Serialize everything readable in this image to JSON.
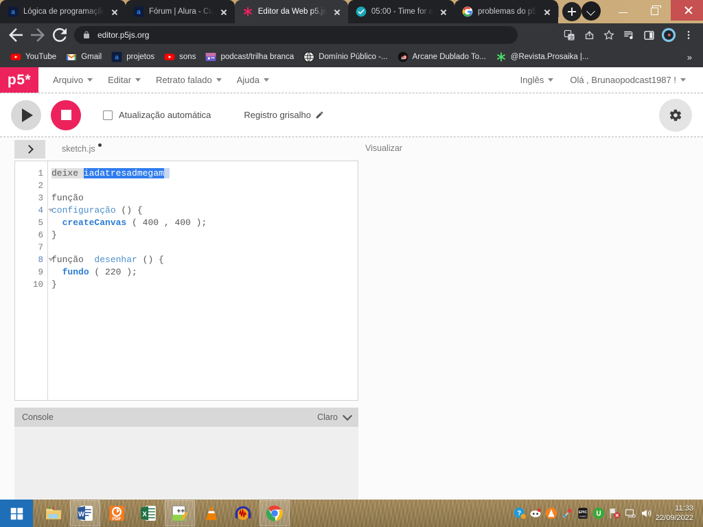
{
  "browser": {
    "tabs": [
      {
        "title": "Lógica de programação",
        "icon": "alura-icon",
        "active": false
      },
      {
        "title": "Fórum | Alura - Cu",
        "icon": "alura-icon",
        "active": false
      },
      {
        "title": "Editor da Web p5.js",
        "icon": "p5-asterisk-icon",
        "active": true
      },
      {
        "title": "05:00 - Time for a",
        "icon": "timer-check-icon",
        "active": false
      },
      {
        "title": "problemas do p5",
        "icon": "google-icon",
        "active": false
      }
    ],
    "new_tab_label": "+",
    "window_controls": {
      "minimize": "–",
      "maximize": "❐",
      "close": "✕"
    },
    "address": {
      "url": "editor.p5js.org",
      "lock_icon": "lock-icon",
      "back_icon": "back-arrow-icon",
      "forward_icon": "forward-arrow-icon",
      "reload_icon": "reload-icon"
    },
    "toolbar_icons": [
      "translate-icon",
      "share-icon",
      "bookmark-star-icon",
      "media-playlist-icon",
      "sidepanel-icon",
      "profile-avatar-icon",
      "chrome-menu-icon"
    ],
    "bookmarks": [
      {
        "label": "YouTube",
        "icon": "youtube-icon"
      },
      {
        "label": "Gmail",
        "icon": "gmail-icon"
      },
      {
        "label": "projetos",
        "icon": "alura-icon"
      },
      {
        "label": "sons",
        "icon": "youtube-icon"
      },
      {
        "label": "podcast/trilha branca",
        "icon": "podcast-thumb-icon"
      },
      {
        "label": "Domínio Público -...",
        "icon": "globe-icon"
      },
      {
        "label": "Arcane Dublado To...",
        "icon": "adblock-icon"
      },
      {
        "label": "@Revista.Prosaika |...",
        "icon": "asterisk-green-icon"
      }
    ],
    "bookmarks_overflow": "»"
  },
  "p5": {
    "logo": "p5*",
    "menu": [
      {
        "label": "Arquivo"
      },
      {
        "label": "Editar"
      },
      {
        "label": "Retrato falado"
      },
      {
        "label": "Ajuda"
      }
    ],
    "language": "Inglês",
    "account": "Olá , Brunaopodcast1987 !",
    "toolbar": {
      "play_label": "play-button",
      "stop_label": "stop-button",
      "autorefresh_label": "Atualização automática",
      "autorefresh_checked": false,
      "log_label": "Registro grisalho",
      "log_icon": "pencil-icon",
      "settings_icon": "gear-icon"
    },
    "file": {
      "name": "sketch.js",
      "unsaved": true,
      "sidebar_toggle_icon": "chevron-right-icon"
    },
    "preview_label": "Visualizar",
    "console": {
      "title": "Console",
      "theme": "Claro",
      "collapse_icon": "chevron-down-icon"
    },
    "editor": {
      "line_numbers": [
        "1",
        "2",
        "3",
        "4",
        "5",
        "6",
        "7",
        "8",
        "9",
        "10"
      ],
      "fold_lines": [
        4,
        8
      ],
      "marked_lines": [
        4,
        8
      ],
      "lines": [
        {
          "n": 1,
          "tokens": [
            {
              "t": "deixe ",
              "c": "kw",
              "bg": "hl"
            },
            {
              "t": "iadatresadmegam",
              "c": "sel"
            },
            {
              "t": " ",
              "c": "selpad"
            }
          ]
        },
        {
          "n": 2,
          "tokens": []
        },
        {
          "n": 3,
          "tokens": [
            {
              "t": "função",
              "c": "kw"
            }
          ]
        },
        {
          "n": 4,
          "tokens": [
            {
              "t": "configuração",
              "c": "name"
            },
            {
              "t": " () {",
              "c": "punct"
            }
          ]
        },
        {
          "n": 5,
          "tokens": [
            {
              "t": "  ",
              "c": "punct"
            },
            {
              "t": "createCanvas",
              "c": "fn"
            },
            {
              "t": " ( ",
              "c": "punct"
            },
            {
              "t": "400",
              "c": "num"
            },
            {
              "t": " , ",
              "c": "punct"
            },
            {
              "t": "400",
              "c": "num"
            },
            {
              "t": " );",
              "c": "punct"
            }
          ]
        },
        {
          "n": 6,
          "tokens": [
            {
              "t": "}",
              "c": "punct"
            }
          ]
        },
        {
          "n": 7,
          "tokens": []
        },
        {
          "n": 8,
          "tokens": [
            {
              "t": "função",
              "c": "kw"
            },
            {
              "t": "  ",
              "c": "punct"
            },
            {
              "t": "desenhar",
              "c": "name"
            },
            {
              "t": " () {",
              "c": "punct"
            }
          ]
        },
        {
          "n": 9,
          "tokens": [
            {
              "t": "  ",
              "c": "punct"
            },
            {
              "t": "fundo",
              "c": "fn"
            },
            {
              "t": " ( ",
              "c": "punct"
            },
            {
              "t": "220",
              "c": "num"
            },
            {
              "t": " );",
              "c": "punct"
            }
          ]
        },
        {
          "n": 10,
          "tokens": [
            {
              "t": "}",
              "c": "punct"
            }
          ]
        }
      ]
    },
    "colors": {
      "brand": "#ed225d",
      "selection": "#2f7ced",
      "keyword": "#5a5a5a",
      "function": "#2d7dd2"
    }
  },
  "taskbar": {
    "start_icon": "windows-start-icon",
    "apps": [
      {
        "icon": "file-explorer-icon",
        "open": false
      },
      {
        "icon": "word-icon",
        "open": true
      },
      {
        "icon": "pdf-icon",
        "open": false
      },
      {
        "icon": "excel-icon",
        "open": false
      },
      {
        "icon": "notepadpp-icon",
        "open": true
      },
      {
        "icon": "vlc-icon",
        "open": false
      },
      {
        "icon": "audacity-icon",
        "open": false
      },
      {
        "icon": "chrome-icon",
        "open": true
      }
    ],
    "tray": [
      "help-icon",
      "discord-icon",
      "avast-icon",
      "tool-icon",
      "epic-games-icon",
      "utorrent-icon",
      "network-error-icon",
      "display-icon",
      "volume-icon"
    ],
    "time": "11:33",
    "date": "22/09/2022"
  }
}
